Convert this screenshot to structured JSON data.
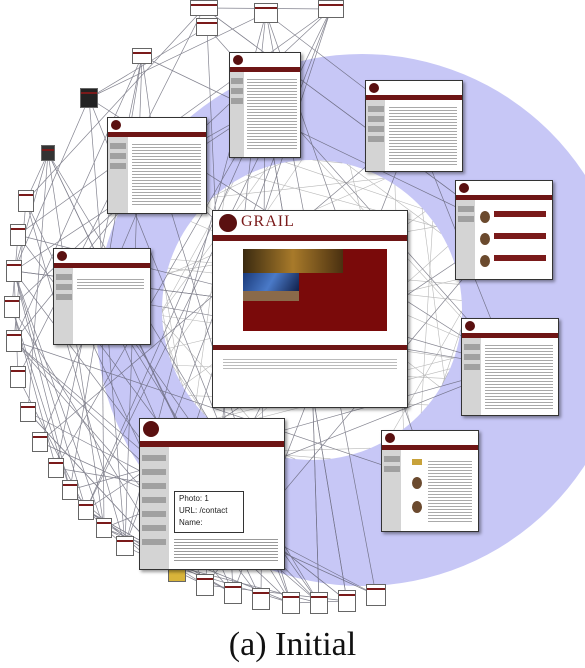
{
  "caption": "(a) Initial",
  "colors": {
    "ring": "#c7c7f6",
    "ringInner": "#ffffff",
    "edge": "#6a6a7a",
    "accent": "#7a1a1a"
  },
  "center_page": {
    "logo_text": "GRAIL",
    "info": {
      "line1": "Photo: 1",
      "line2": "URL: /contact",
      "line3": "Name:"
    }
  }
}
